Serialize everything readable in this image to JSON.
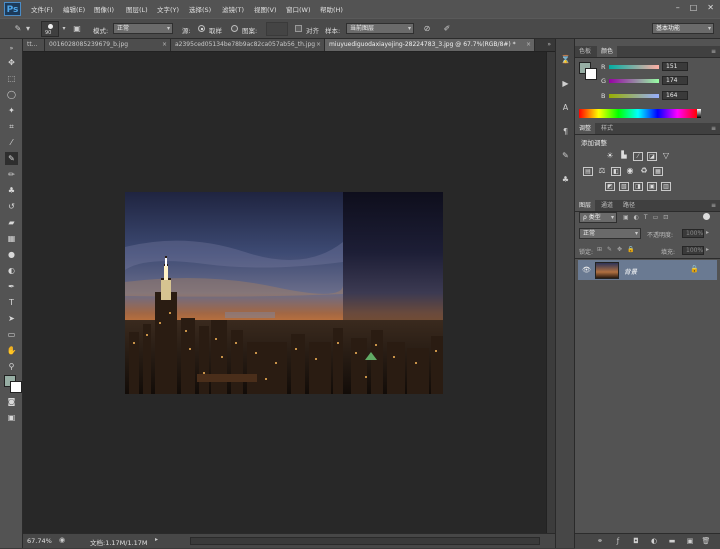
{
  "app": {
    "logo": "Ps"
  },
  "menu": [
    "文件(F)",
    "编辑(E)",
    "图像(I)",
    "图层(L)",
    "文字(Y)",
    "选择(S)",
    "滤镜(T)",
    "视图(V)",
    "窗口(W)",
    "帮助(H)"
  ],
  "options_bar": {
    "brush_size": "90",
    "mode_label": "模式:",
    "mode_value": "正常",
    "source_label": "源:",
    "source_sampled": "取样",
    "source_pattern": "图案:",
    "aligned_label": "对齐",
    "sample_label": "样本:",
    "sample_value": "当前图层",
    "workspace": "基本功能"
  },
  "tabs": [
    {
      "label": "tt..."
    },
    {
      "label": "0016028085239679_b.jpg"
    },
    {
      "label": "a2395ced05134be78b9ac82ca057ab56_th.jpg"
    },
    {
      "label": "miuyuediguodaxiayejing-28224783_3.jpg @ 67.7%(RGB/8#) *"
    }
  ],
  "status": {
    "zoom": "67.74%",
    "doc": "文档:1.17M/1.17M"
  },
  "color_panel": {
    "tabs": [
      "色板",
      "颜色"
    ],
    "r": "151",
    "g": "174",
    "b": "164",
    "r_label": "R",
    "g_label": "G",
    "b_label": "B",
    "fg_color": "#97aea4"
  },
  "adjust_panel": {
    "tabs": [
      "调整",
      "样式"
    ],
    "title": "添加调整"
  },
  "layers_panel": {
    "tabs": [
      "图层",
      "通道",
      "路径"
    ],
    "kind_label": "ρ 类型",
    "blend": "正常",
    "opacity_label": "不透明度:",
    "opacity": "100%",
    "lock_label": "锁定:",
    "fill_label": "填充:",
    "fill": "100%",
    "layer_name": "背景"
  }
}
